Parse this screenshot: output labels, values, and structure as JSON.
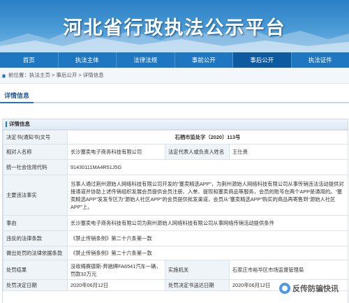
{
  "banner": {
    "title": "河北省行政执法公示平台"
  },
  "nav": {
    "items": [
      {
        "label": "首页",
        "active": false
      },
      {
        "label": "执法主体",
        "active": false
      },
      {
        "label": "法律法规",
        "active": false
      },
      {
        "label": "事前公开",
        "active": false
      },
      {
        "label": "事后公开",
        "active": true
      },
      {
        "label": "执法证件",
        "active": false
      }
    ]
  },
  "breadcrumb": {
    "prefix": "前位置：",
    "items": [
      "执法主页",
      "事后公开",
      "详情信息"
    ],
    "separator": ">"
  },
  "section": {
    "title": "详情信息"
  },
  "panel": {
    "title": "详情信息"
  },
  "table": {
    "decision_no_label": "决定书(通知书)文号",
    "decision_no_value": "石栖市监处字〔2020〕113号",
    "party_label": "相对人名称",
    "party_value": "长沙塞卖电子商务科技有限公司",
    "legal_rep_label": "法定代表人或负责人姓名",
    "legal_rep_value": "王仕贵",
    "credit_code_label": "统一社会信用代码",
    "credit_code_value": "91430111MA4R51J5G",
    "facts_label": "主要违法事实",
    "facts_value": "当事人通过荆州源始人网络科技有限公司开发的“塞卖精选APP”，为荆州源始人网络科技有限公司从事传销违法活动提供对接通道并协助上述传销组织发展会员提供会员注册、入单、提现和塞卖商品等服务，会员的账号在两个APP是通用的。“塞卖精选APP”发发专区为“源始人社区APP”的会员提供批发渠道，会员从“塞卖精选APP”购买的商品再寄售到“源始人社区APP”上。",
    "reason_label": "事由",
    "reason_value": "长沙塞卖电子商务科技有限公司为荆州源始人网络科技有限公司从事网络传销活动提供条件",
    "violated_law_label": "违反的法律条款",
    "violated_law_value": "《禁止传销条例》第二十六条第一款",
    "basis_label": "做出处罚的法律依据条款",
    "basis_value": "《禁止传销条例》第二十六条第一款",
    "result_label": "处罚结果",
    "result_value": "没收梅赛德斯-奔驰牌FA6541汽车一辆，罚款32万元",
    "authority_label": "实施机关",
    "authority_value": "石家庄市裕华区市场监督管理局",
    "decision_date_label": "处罚决定日期",
    "decision_date_value": "2020年06月12日",
    "delivery_date_label": "处罚决定书送达日期",
    "delivery_date_value": "2020年06月12日"
  },
  "watermark": {
    "text": "反传防骗快讯"
  }
}
